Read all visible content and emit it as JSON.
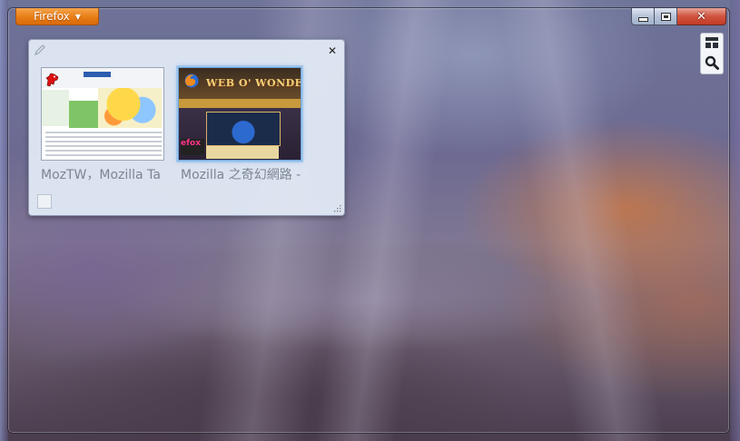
{
  "app": {
    "menu_button_label": "Firefox",
    "colors": {
      "accent": "#e77d15",
      "close": "#c33b24",
      "panel": "#e2e9f4"
    }
  },
  "window_controls": {
    "minimize": "minimize-icon",
    "maximize": "maximize-icon",
    "close": "close-icon"
  },
  "side_tools": {
    "items": [
      "tab-groups-grid-icon",
      "search-icon"
    ]
  },
  "tab_group": {
    "tabs": [
      {
        "title": "MozTW，Mozilla Ta",
        "favicon": "moztw-dinosaur-icon",
        "thumb_label": "",
        "active": false
      },
      {
        "title": "Mozilla 之奇幻網路 -",
        "favicon": "firefox-icon",
        "thumb_label": "WEB O' WONDER",
        "side_label": "efox",
        "active": true
      }
    ]
  }
}
